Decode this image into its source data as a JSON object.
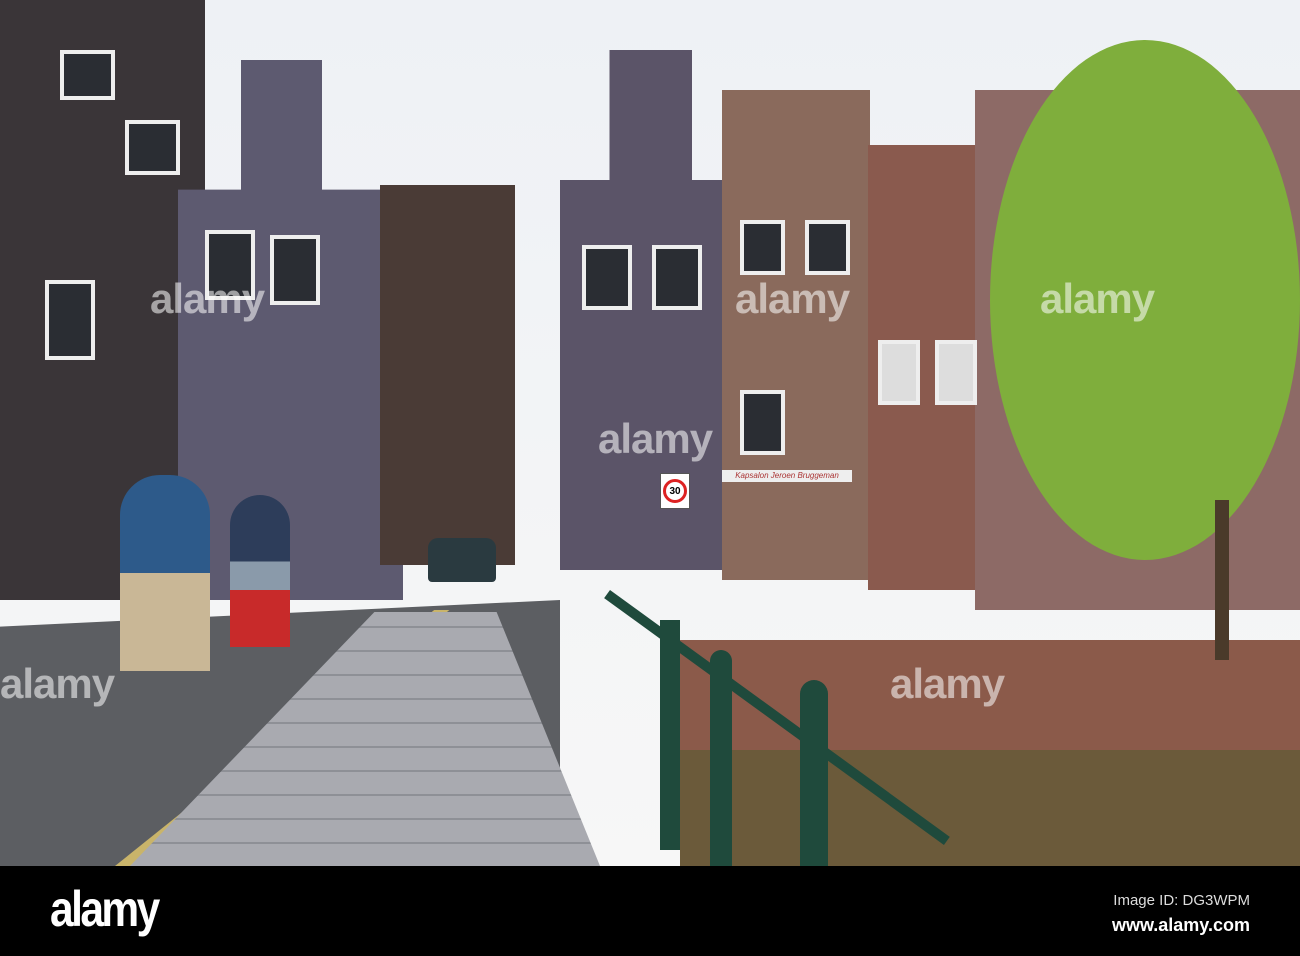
{
  "photo": {
    "speed_sign": "30",
    "shop_sign": "Kapsalon Jeroen Bruggeman",
    "watermarks": [
      "alamy",
      "alamy",
      "alamy",
      "alamy",
      "alamy",
      "alamy"
    ]
  },
  "footer": {
    "logo": "alamy",
    "image_id": "Image ID: DG3WPM",
    "url": "www.alamy.com"
  },
  "colors": {
    "sky": "#eef1f5",
    "brick": "#8b5a4a",
    "water": "#6b5a3a",
    "railing": "#1f4a3c",
    "tree": "#7fae3c"
  }
}
